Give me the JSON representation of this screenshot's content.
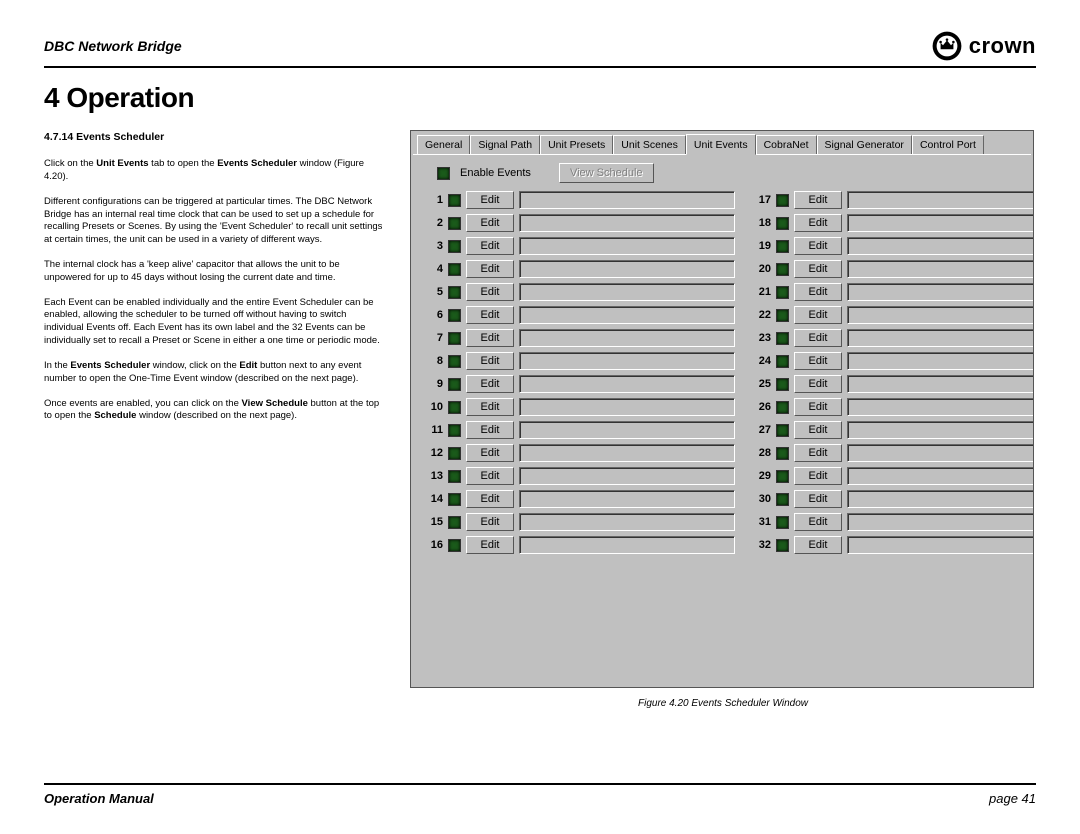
{
  "header": {
    "product": "DBC Network Bridge",
    "brand": "crown"
  },
  "section": {
    "title": "4 Operation",
    "subhead": "4.7.14 Events Scheduler"
  },
  "paras": {
    "p1a": "Click on the ",
    "p1b": "Unit Events",
    "p1c": " tab to open the ",
    "p1d": "Events Scheduler",
    "p1e": " window (Figure 4.20).",
    "p2": "Different configurations can be triggered at particular times. The DBC Network Bridge has an internal real time clock that can be used to set up a schedule for recalling Presets or Scenes. By using the 'Event Scheduler' to recall unit settings at certain times, the unit can be used in a variety of different ways.",
    "p3": "The internal clock has a 'keep alive' capacitor that allows the unit to be unpowered for up to 45 days without losing the current date and time.",
    "p4": "Each Event can be enabled individually and the entire Event Scheduler can be enabled, allowing the scheduler to be turned off without having to switch individual Events off. Each Event has its own label and the 32 Events can be individually set to recall a Preset or Scene in either a one time or periodic mode.",
    "p5a": "In the ",
    "p5b": "Events Scheduler",
    "p5c": " window, click on the ",
    "p5d": "Edit",
    "p5e": " button next to any event number to open the One-Time Event window (described on the next page).",
    "p6a": "Once events are enabled, you can click on the ",
    "p6b": "View Schedule",
    "p6c": " button at the top to open the ",
    "p6d": "Schedule",
    "p6e": " window (described on the next page)."
  },
  "ui": {
    "tabs": [
      "General",
      "Signal Path",
      "Unit Presets",
      "Unit Scenes",
      "Unit Events",
      "CobraNet",
      "Signal Generator",
      "Control Port"
    ],
    "active_tab": 4,
    "enable_label": "Enable Events",
    "view_schedule_label": "View Schedule",
    "edit_label": "Edit",
    "event_count": 32
  },
  "caption": "Figure 4.20  Events Scheduler Window",
  "footer": {
    "left": "Operation Manual",
    "right": "page 41"
  }
}
